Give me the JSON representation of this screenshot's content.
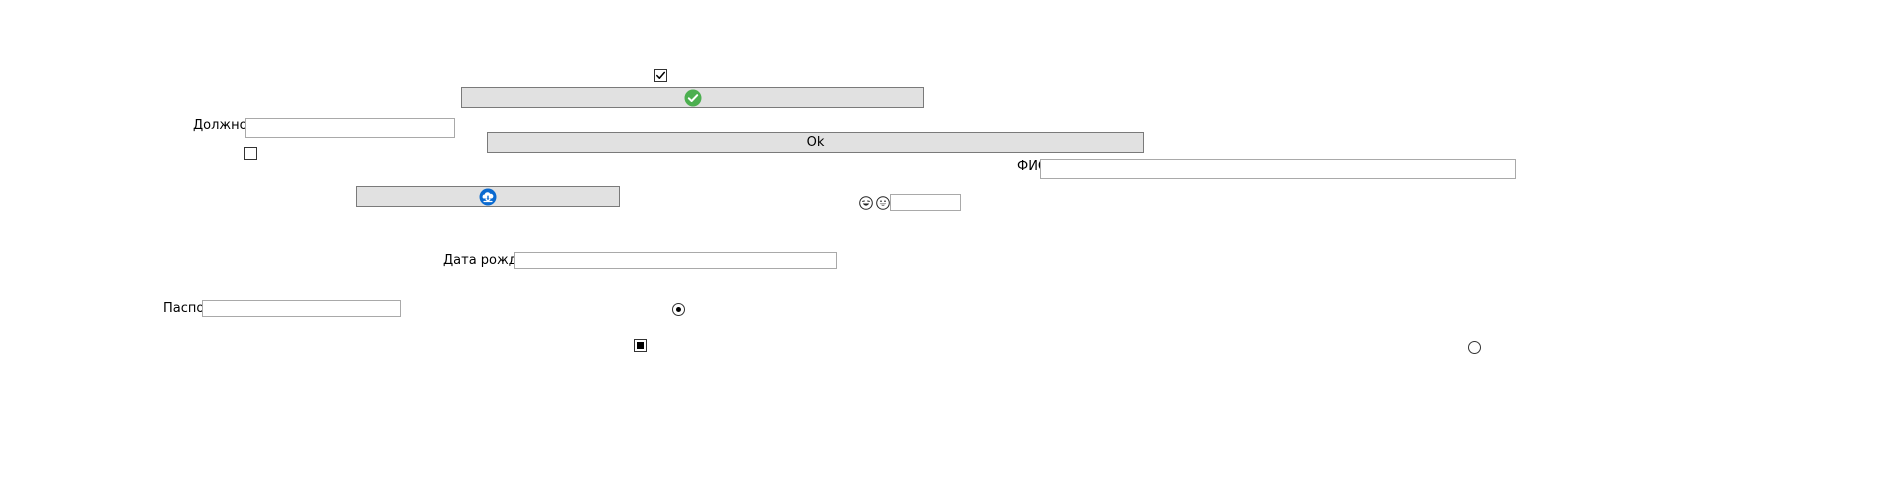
{
  "labels": {
    "position": "Должность",
    "fio": "ФИО",
    "birthdate": "Дата рождения",
    "passport": "Паспорт"
  },
  "fields": {
    "position": {
      "value": "",
      "placeholder": ""
    },
    "fio": {
      "value": "",
      "placeholder": ""
    },
    "birthdate": {
      "value": "",
      "placeholder": ""
    },
    "passport": {
      "value": "",
      "placeholder": ""
    },
    "small": {
      "value": "",
      "placeholder": ""
    }
  },
  "buttons": {
    "ok_label": "Ok",
    "check_icon": "check-circle-icon",
    "cloud_icon": "cloud-arrow-icon",
    "check_color": "#4caf50",
    "cloud_color": "#0a6ad0"
  },
  "checkboxes": {
    "top_checked": true,
    "left_checked": false,
    "bottom_indeterminate": true
  },
  "radios": {
    "middle_selected": true,
    "right_selected": false
  },
  "emoji_icons": [
    "laughing-face-icon",
    "grinning-face-icon"
  ]
}
